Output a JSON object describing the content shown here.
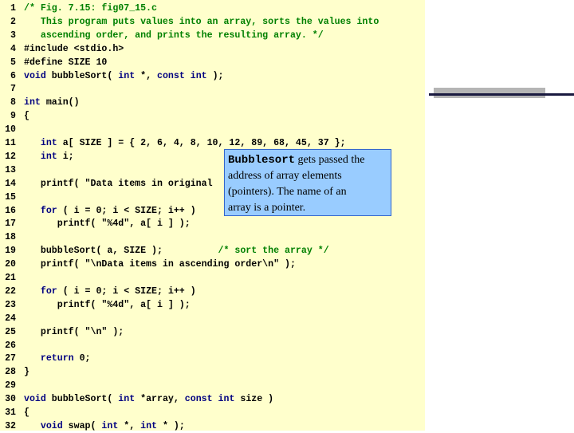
{
  "colors": {
    "code_bg": "#ffffcc",
    "keyword": "#000080",
    "comment": "#008000",
    "callout_bg": "#99ccff",
    "callout_border": "#3366cc"
  },
  "lines": [
    {
      "n": "1",
      "segs": [
        {
          "t": "/* Fig. 7.15: fig07_15.c",
          "c": "cm"
        }
      ]
    },
    {
      "n": "2",
      "segs": [
        {
          "t": "   This program puts values into an array, sorts the values into",
          "c": "cm"
        }
      ]
    },
    {
      "n": "3",
      "segs": [
        {
          "t": "   ascending order, and prints the resulting array. */",
          "c": "cm"
        }
      ]
    },
    {
      "n": "4",
      "segs": [
        {
          "t": "#include <stdio.h>",
          "c": ""
        }
      ]
    },
    {
      "n": "5",
      "segs": [
        {
          "t": "#define SIZE 10",
          "c": ""
        }
      ]
    },
    {
      "n": "6",
      "segs": [
        {
          "t": "void",
          "c": "kw"
        },
        {
          "t": " bubbleSort( ",
          "c": ""
        },
        {
          "t": "int",
          "c": "kw"
        },
        {
          "t": " *, ",
          "c": ""
        },
        {
          "t": "const int",
          "c": "kw"
        },
        {
          "t": " );",
          "c": ""
        }
      ]
    },
    {
      "n": "7",
      "segs": []
    },
    {
      "n": "8",
      "segs": [
        {
          "t": "int",
          "c": "kw"
        },
        {
          "t": " main()",
          "c": ""
        }
      ]
    },
    {
      "n": "9",
      "segs": [
        {
          "t": "{",
          "c": ""
        }
      ]
    },
    {
      "n": "10",
      "segs": []
    },
    {
      "n": "11",
      "segs": [
        {
          "t": "   ",
          "c": ""
        },
        {
          "t": "int",
          "c": "kw"
        },
        {
          "t": " a[ SIZE ] = { 2, 6, 4, 8, 10, 12, 89, 68, 45, 37 };",
          "c": ""
        }
      ]
    },
    {
      "n": "12",
      "segs": [
        {
          "t": "   ",
          "c": ""
        },
        {
          "t": "int",
          "c": "kw"
        },
        {
          "t": " i;",
          "c": ""
        }
      ]
    },
    {
      "n": "13",
      "segs": []
    },
    {
      "n": "14",
      "segs": [
        {
          "t": "   printf( \"Data items in original",
          "c": ""
        }
      ]
    },
    {
      "n": "15",
      "segs": []
    },
    {
      "n": "16",
      "segs": [
        {
          "t": "   ",
          "c": ""
        },
        {
          "t": "for",
          "c": "kw"
        },
        {
          "t": " ( i = 0; i < SIZE; i++ )",
          "c": ""
        }
      ]
    },
    {
      "n": "17",
      "segs": [
        {
          "t": "      printf( \"%4d\", a[ i ] );",
          "c": ""
        }
      ]
    },
    {
      "n": "18",
      "segs": []
    },
    {
      "n": "19",
      "segs": [
        {
          "t": "   bubbleSort( a, SIZE );          ",
          "c": ""
        },
        {
          "t": "/* sort the array */",
          "c": "cm"
        }
      ]
    },
    {
      "n": "20",
      "segs": [
        {
          "t": "   printf( \"\\nData items in ascending order\\n\" );",
          "c": ""
        }
      ]
    },
    {
      "n": "21",
      "segs": []
    },
    {
      "n": "22",
      "segs": [
        {
          "t": "   ",
          "c": ""
        },
        {
          "t": "for",
          "c": "kw"
        },
        {
          "t": " ( i = 0; i < SIZE; i++ )",
          "c": ""
        }
      ]
    },
    {
      "n": "23",
      "segs": [
        {
          "t": "      printf( \"%4d\", a[ i ] );",
          "c": ""
        }
      ]
    },
    {
      "n": "24",
      "segs": []
    },
    {
      "n": "25",
      "segs": [
        {
          "t": "   printf( \"\\n\" );",
          "c": ""
        }
      ]
    },
    {
      "n": "26",
      "segs": []
    },
    {
      "n": "27",
      "segs": [
        {
          "t": "   ",
          "c": ""
        },
        {
          "t": "return",
          "c": "kw"
        },
        {
          "t": " 0;",
          "c": ""
        }
      ]
    },
    {
      "n": "28",
      "segs": [
        {
          "t": "}",
          "c": ""
        }
      ]
    },
    {
      "n": "29",
      "segs": []
    },
    {
      "n": "30",
      "segs": [
        {
          "t": "void",
          "c": "kw"
        },
        {
          "t": " bubbleSort( ",
          "c": ""
        },
        {
          "t": "int",
          "c": "kw"
        },
        {
          "t": " *array, ",
          "c": ""
        },
        {
          "t": "const int",
          "c": "kw"
        },
        {
          "t": " size )",
          "c": ""
        }
      ]
    },
    {
      "n": "31",
      "segs": [
        {
          "t": "{",
          "c": ""
        }
      ]
    },
    {
      "n": "32",
      "segs": [
        {
          "t": "   ",
          "c": ""
        },
        {
          "t": "void",
          "c": "kw"
        },
        {
          "t": " swap( ",
          "c": ""
        },
        {
          "t": "int",
          "c": "kw"
        },
        {
          "t": " *, ",
          "c": ""
        },
        {
          "t": "int",
          "c": "kw"
        },
        {
          "t": " * );",
          "c": ""
        }
      ]
    }
  ],
  "callout": {
    "mono_word": "Bubblesort",
    "text_1": " gets passed the",
    "text_2": "address of array elements",
    "text_3": "(pointers).  The name of an",
    "text_4": "array is a pointer."
  }
}
